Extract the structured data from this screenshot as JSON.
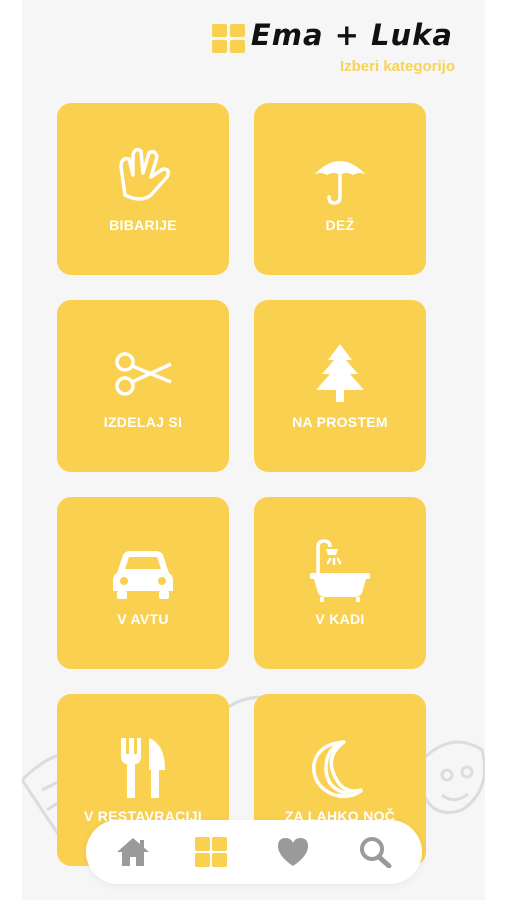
{
  "header": {
    "title": "Ema + Luka",
    "subtitle": "Izberi kategorijo",
    "grid_icon": "grid-icon"
  },
  "categories": [
    {
      "label": "BIBARIJE",
      "icon": "hand-icon"
    },
    {
      "label": "DEŽ",
      "icon": "umbrella-icon"
    },
    {
      "label": "IZDELAJ SI",
      "icon": "scissors-icon"
    },
    {
      "label": "NA PROSTEM",
      "icon": "tree-icon"
    },
    {
      "label": "V AVTU",
      "icon": "car-icon"
    },
    {
      "label": "V KADI",
      "icon": "bathtub-icon"
    },
    {
      "label": "V RESTAVRACIJI",
      "icon": "cutlery-icon"
    },
    {
      "label": "ZA LAHKO NOČ",
      "icon": "moon-icon"
    }
  ],
  "nav": {
    "items": [
      "home-icon",
      "grid-icon",
      "heart-icon",
      "search-icon"
    ],
    "active": "grid-icon"
  },
  "colors": {
    "accent": "#f9d04f",
    "title": "#111111",
    "subtitle": "#f7d358",
    "nav_icon": "#9a9a9a",
    "background": "#f6f6f6"
  }
}
